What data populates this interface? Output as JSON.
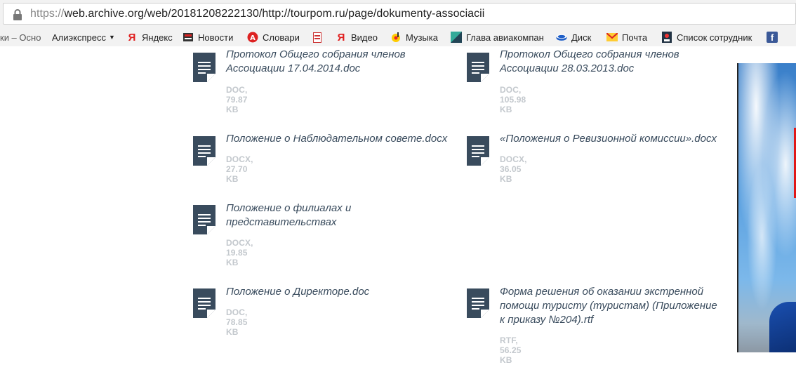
{
  "browser": {
    "url_scheme": "https://",
    "url_rest": "web.archive.org/web/20181208222130/http://tourpom.ru/page/dokumenty-associacii"
  },
  "bookmarks": [
    {
      "label": "ки – Осно",
      "icon": "folder-icon"
    },
    {
      "label": "Алиэкспресс",
      "icon": "dropdown-arrow"
    },
    {
      "label": "Яндекс",
      "icon": "yandex-icon"
    },
    {
      "label": "Новости",
      "icon": "news-icon"
    },
    {
      "label": "Словари",
      "icon": "dictionary-icon"
    },
    {
      "label": "",
      "icon": "pdf-icon"
    },
    {
      "label": "Видео",
      "icon": "yandex-video-icon"
    },
    {
      "label": "Музыка",
      "icon": "music-icon"
    },
    {
      "label": "Глава авиакомпан",
      "icon": "aviation-icon"
    },
    {
      "label": "Диск",
      "icon": "disk-icon"
    },
    {
      "label": "Почта",
      "icon": "mail-icon"
    },
    {
      "label": "Список сотрудник",
      "icon": "staff-list-icon"
    },
    {
      "label": "",
      "icon": "facebook-icon"
    }
  ],
  "documents": [
    {
      "title": "Протокол Общего собрания членов Ассоциации 17.04.2014.doc",
      "meta": "DOC, 79.87 KB"
    },
    {
      "title": "Протокол Общего собрания членов Ассоциации 28.03.2013.doc",
      "meta": "DOC, 105.98 KB"
    },
    {
      "title": "Положение о Наблюдательном совете.docx",
      "meta": "DOCX, 27.70 KB"
    },
    {
      "title": "«Положения о Ревизионной комиссии».docx",
      "meta": "DOCX, 36.05 KB"
    },
    {
      "title": "Положение о филиалах и представительствах",
      "meta": "DOCX, 19.85 KB"
    },
    {
      "title": "Положение о Директоре.doc",
      "meta": "DOC, 78.85 KB"
    },
    {
      "title": "Форма решения об оказании экстренной помощи туристу (туристам) (Приложение к приказу №204).rtf",
      "meta": "RTF, 56.25 KB"
    }
  ],
  "colors": {
    "doc_icon": "#394b5d",
    "doc_title": "#394b5d",
    "doc_meta": "#c3c8cd"
  }
}
